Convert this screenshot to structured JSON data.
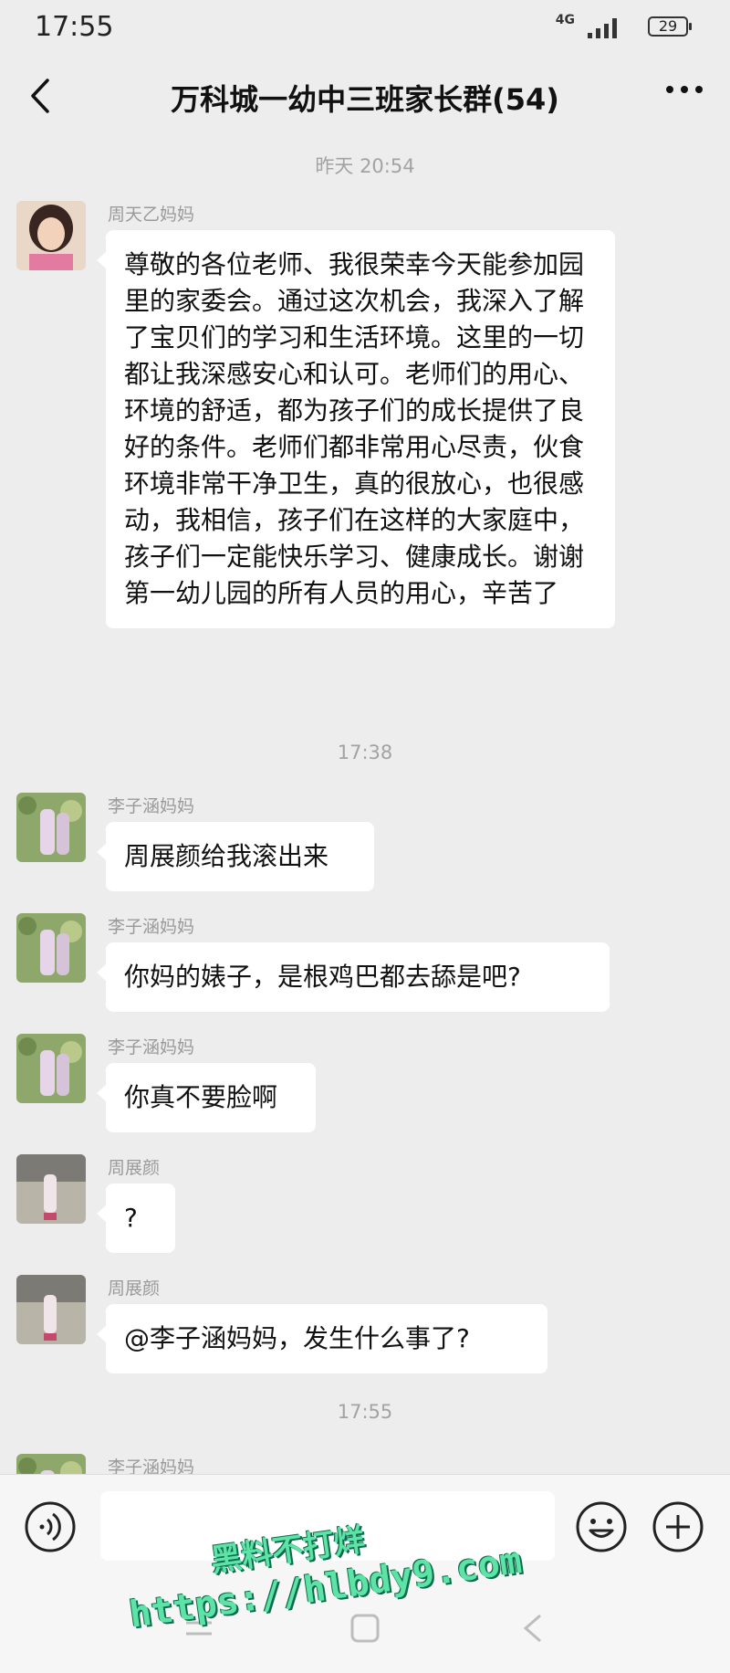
{
  "status": {
    "time": "17:55",
    "network": "4G",
    "battery": "29"
  },
  "header": {
    "title": "万科城一幼中三班家长群(54)"
  },
  "chat": {
    "timestamps": [
      "昨天 20:54",
      "17:38",
      "17:55"
    ],
    "messages": [
      {
        "sender": "周天乙妈妈",
        "text": "尊敬的各位老师、我很荣幸今天能参加园里的家委会。通过这次机会，我深入了解了宝贝们的学习和生活环境。这里的一切都让我深感安心和认可。老师们的用心、环境的舒适，都为孩子们的成长提供了良好的条件。老师们都非常用心尽责，伙食环境非常干净卫生，真的很放心，也很感动，我相信，孩子们在这样的大家庭中，孩子们一定能快乐学习、健康成长。谢谢第一幼儿园的所有人员的用心，辛苦了"
      },
      {
        "sender": "李子涵妈妈",
        "text": "周展颜给我滚出来"
      },
      {
        "sender": "李子涵妈妈",
        "text": "你妈的婊子，是根鸡巴都去舔是吧?"
      },
      {
        "sender": "李子涵妈妈",
        "text": "你真不要脸啊"
      },
      {
        "sender": "周展颜",
        "text": "?"
      },
      {
        "sender": "周展颜",
        "text": "@李子涵妈妈，发生什么事了?"
      },
      {
        "sender": "李子涵妈妈",
        "text": ""
      }
    ]
  },
  "watermark": {
    "line1": "黑料不打烊",
    "line2": "https://hlbdy9.com"
  },
  "icons": {
    "back": "chevron-left-icon",
    "more": "more-icon",
    "voice": "voice-icon",
    "emoji": "emoji-icon",
    "plus": "plus-icon"
  },
  "colors": {
    "background": "#ededed",
    "bubble": "#ffffff",
    "watermark": "#5de3a6"
  }
}
